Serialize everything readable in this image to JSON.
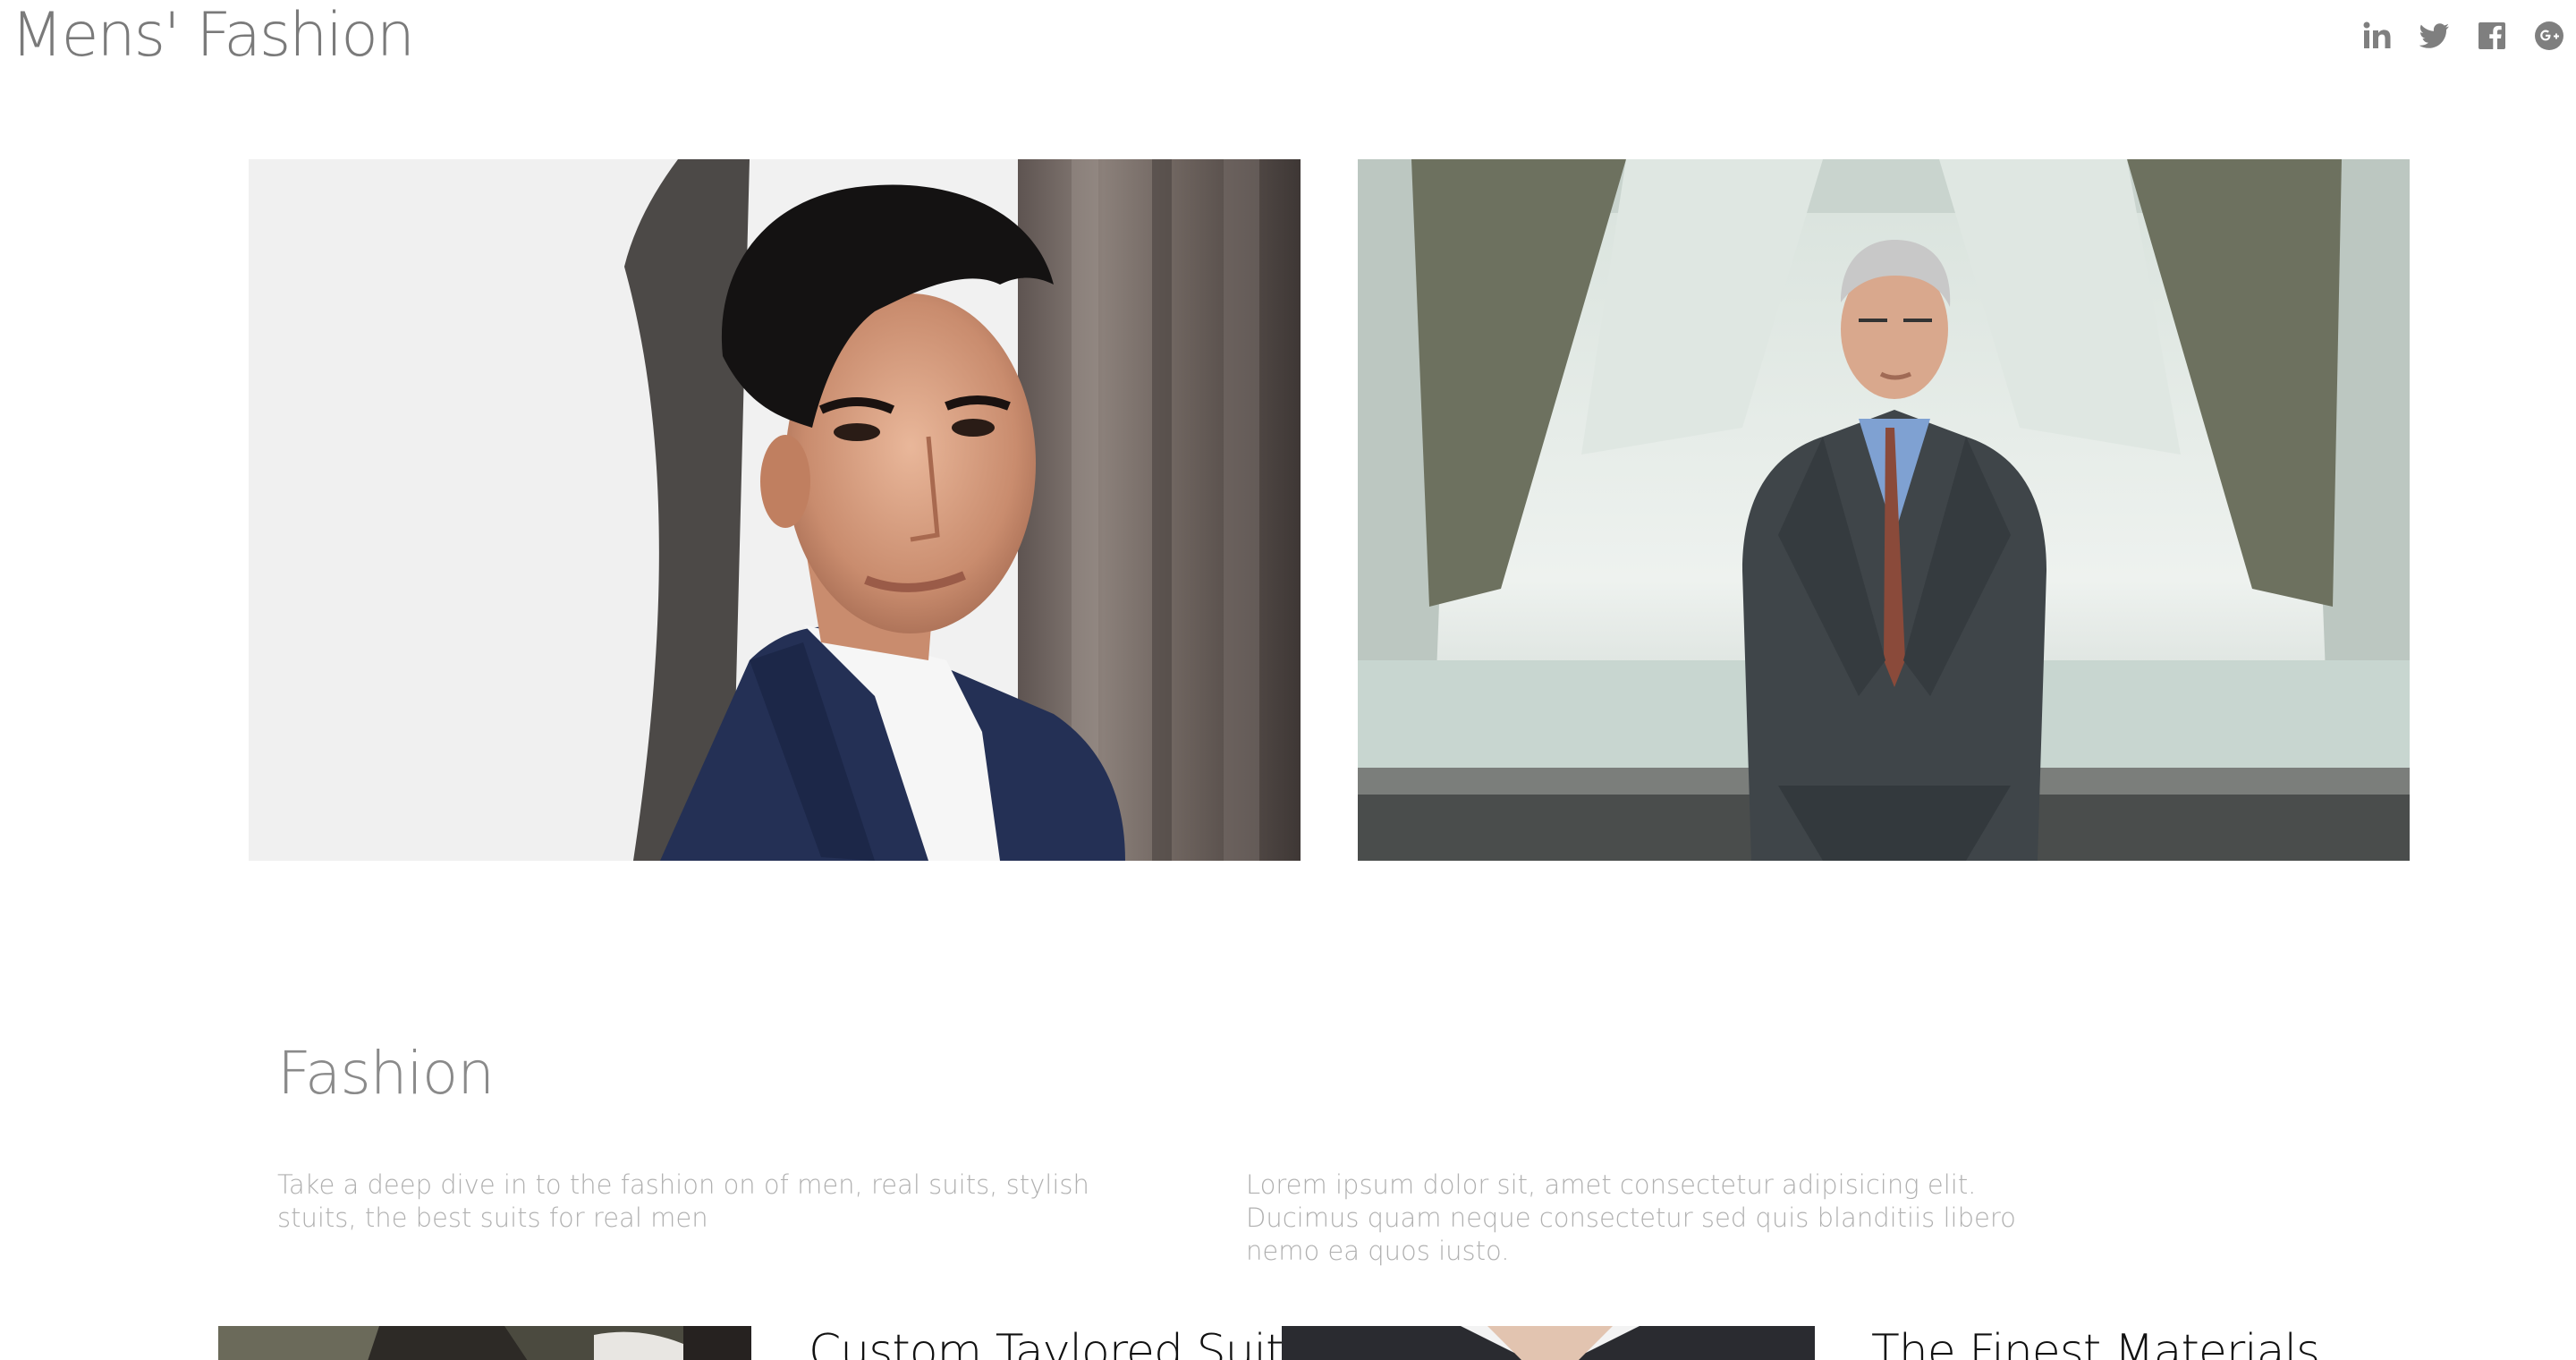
{
  "header": {
    "site_title": "Mens' Fashion",
    "social": [
      {
        "icon": "linkedin-icon",
        "label": "in"
      },
      {
        "icon": "twitter-icon",
        "label": ""
      },
      {
        "icon": "facebook-icon",
        "label": ""
      },
      {
        "icon": "google-plus-icon",
        "label": ""
      }
    ]
  },
  "hero": {
    "images": [
      {
        "icon": "young-man-portrait-photo"
      },
      {
        "icon": "older-man-in-suit-photo"
      }
    ]
  },
  "section": {
    "heading": "Fashion",
    "paragraph_left": "Take a deep dive in to the fashion on of men, real suits, stylish stuits, the best suits for real men",
    "paragraph_right": "Lorem ipsum dolor sit, amet consectetur adipisicing elit. Ducimus quam neque consectetur sed quis blanditiis libero nemo ea quos iusto."
  },
  "features": [
    {
      "title": "Custom Taylored Suits"
    },
    {
      "title": "The Finest Materials"
    }
  ],
  "colors": {
    "title_gray": "#7a7a7a",
    "text_light": "#b0b0b0",
    "icon_gray": "#7f7f7f",
    "feature_text": "#111111"
  }
}
